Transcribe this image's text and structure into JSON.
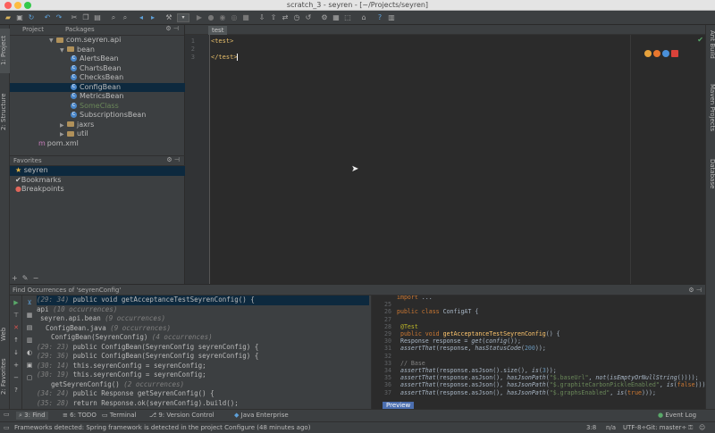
{
  "window": {
    "title": "scratch_3 - seyren - [~/Projects/seyren]"
  },
  "left_strip": {
    "project": "1: Project",
    "structure": "2: Structure",
    "web": "Web",
    "favorites": "2: Favorites"
  },
  "right_strip": {
    "ant": "Ant Build",
    "maven": "Maven Projects",
    "database": "Database"
  },
  "project_panel": {
    "tabs": [
      "Project",
      "Packages"
    ],
    "tree": [
      {
        "label": "com.seyren.api",
        "kind": "folder",
        "indent": 1,
        "open": true
      },
      {
        "label": "bean",
        "kind": "folder",
        "indent": 2,
        "open": true
      },
      {
        "label": "AlertsBean",
        "kind": "class",
        "indent": 3
      },
      {
        "label": "ChartsBean",
        "kind": "class",
        "indent": 3
      },
      {
        "label": "ChecksBean",
        "kind": "class",
        "indent": 3
      },
      {
        "label": "ConfigBean",
        "kind": "class",
        "indent": 3,
        "selected": true
      },
      {
        "label": "MetricsBean",
        "kind": "class",
        "indent": 3
      },
      {
        "label": "SomeClass",
        "kind": "class",
        "indent": 3,
        "green": true
      },
      {
        "label": "SubscriptionsBean",
        "kind": "class",
        "indent": 3
      },
      {
        "label": "jaxrs",
        "kind": "folder",
        "indent": 2,
        "open": false
      },
      {
        "label": "util",
        "kind": "folder",
        "indent": 2,
        "open": false
      },
      {
        "label": "pom.xml",
        "kind": "file",
        "indent": 0
      }
    ],
    "favorites_title": "Favorites",
    "favorites": [
      "seyren",
      "Bookmarks",
      "Breakpoints"
    ]
  },
  "editor": {
    "tab": "test",
    "lines": [
      {
        "num": "1",
        "text": "<test>"
      },
      {
        "num": "2",
        "text": ""
      },
      {
        "num": "3",
        "text": "</test>"
      }
    ]
  },
  "find": {
    "title": "Find Occurrences of 'seyrenConfig'",
    "rows": [
      {
        "loc": "(29: 34)",
        "text": "public void getAcceptanceTestSeyrenConfig() {",
        "selected": true
      },
      {
        "loc": "",
        "text": "api",
        "occ": "(10 occurrences)"
      },
      {
        "loc": "",
        "text": "seyren.api.bean",
        "occ": "(9 occurrences)"
      },
      {
        "loc": "",
        "text": "ConfigBean.java",
        "occ": "(9 occurrences)"
      },
      {
        "loc": "",
        "text": "ConfigBean(SeyrenConfig)",
        "occ": "(4 occurrences)"
      },
      {
        "loc": "(29: 23)",
        "text": "public ConfigBean(SeyrenConfig seyrenConfig) {"
      },
      {
        "loc": "(29: 36)",
        "text": "public ConfigBean(SeyrenConfig seyrenConfig) {"
      },
      {
        "loc": "(30: 14)",
        "text": "this.seyrenConfig = seyrenConfig;"
      },
      {
        "loc": "(30: 19)",
        "text": "this.seyrenConfig = seyrenConfig;"
      },
      {
        "loc": "",
        "text": "getSeyrenConfig()",
        "occ": "(2 occurrences)"
      },
      {
        "loc": "(34: 24)",
        "text": "public Response getSeyrenConfig() {"
      },
      {
        "loc": "(35: 28)",
        "text": "return Response.ok(seyrenConfig).build();"
      }
    ],
    "preview_tab": "Preview",
    "preview": [
      {
        "n": "",
        "html": "<span class='kw'>import</span> ..."
      },
      {
        "n": "25",
        "html": ""
      },
      {
        "n": "26",
        "html": "<span class='kw'>public class</span> ConfigAT {"
      },
      {
        "n": "27",
        "html": ""
      },
      {
        "n": "28",
        "html": "    <span class='ann'>@Test</span>"
      },
      {
        "n": "29",
        "html": "    <span class='kw'>public void</span> <span style='color:#ffc66d'>getAcceptanceTestSeyrenConfig</span>() {"
      },
      {
        "n": "30",
        "html": "        Response response = <span class='it'>get</span>(<span class='it'>config</span>());"
      },
      {
        "n": "31",
        "html": "        <span class='it'>assertThat</span>(response, <span class='it'>hasStatusCode</span>(<span class='num'>200</span>));"
      },
      {
        "n": "32",
        "html": ""
      },
      {
        "n": "33",
        "html": "        <span class='cm'>// Base</span>"
      },
      {
        "n": "34",
        "html": "        <span class='it'>assertThat</span>(response.asJson().size(), <span class='it'>is</span>(<span class='num'>3</span>));"
      },
      {
        "n": "35",
        "html": "        <span class='it'>assertThat</span>(response.asJson(), <span class='it'>hasJsonPath</span>(<span class='st'>\"$.baseUrl\"</span>, <span class='it'>not</span>(<span class='it'>isEmptyOrNullString</span>())));"
      },
      {
        "n": "36",
        "html": "        <span class='it'>assertThat</span>(response.asJson(), <span class='it'>hasJsonPath</span>(<span class='st'>\"$.graphiteCarbonPickleEnabled\"</span>, <span class='it'>is</span>(<span class='kw'>false</span>)));"
      },
      {
        "n": "37",
        "html": "        <span class='it'>assertThat</span>(response.asJson(), <span class='it'>hasJsonPath</span>(<span class='st'>\"$.graphsEnabled\"</span>, <span class='it'>is</span>(<span class='kw'>true</span>)));"
      }
    ]
  },
  "bottom_tabs": [
    "3: Find",
    "6: TODO",
    "Terminal",
    "9: Version Control",
    "Java Enterprise"
  ],
  "event_log": "Event Log",
  "status": {
    "message": "Frameworks detected: Spring framework is detected in the project Configure (48 minutes ago)",
    "position": "3:8",
    "line_sep": "n/a",
    "encoding": "UTF-8÷",
    "git": "Git: master÷"
  }
}
